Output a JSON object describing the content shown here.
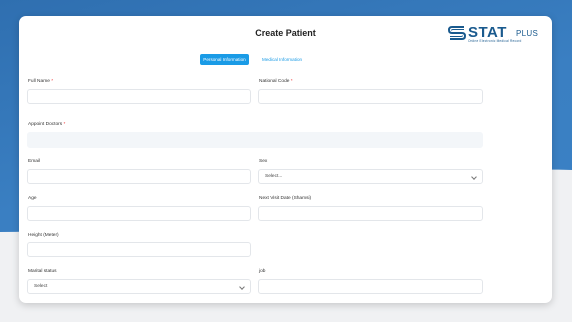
{
  "header": {
    "title": "Create Patient"
  },
  "logo": {
    "word": "STAT",
    "plus": "PLUS",
    "tagline": "Online Electronic Medical Record"
  },
  "tabs": [
    {
      "label": "Personal Information",
      "active": true
    },
    {
      "label": "Medical Information",
      "active": false
    }
  ],
  "form": {
    "full_name": {
      "label": "Full Name",
      "required_mark": "*",
      "value": ""
    },
    "national_code": {
      "label": "National Code",
      "required_mark": "*",
      "value": ""
    },
    "appoint_doctors": {
      "label": "Appoint Doctors",
      "required_mark": "*",
      "value": ""
    },
    "email": {
      "label": "Email",
      "value": ""
    },
    "sex": {
      "label": "Sex",
      "value": "Select..."
    },
    "age": {
      "label": "Age",
      "value": ""
    },
    "next_visit": {
      "label": "Next Visit Date (Shamsi)",
      "value": ""
    },
    "height": {
      "label": "Height (Meter)",
      "value": ""
    },
    "marital_status": {
      "label": "Marital status",
      "value": "Select"
    },
    "job": {
      "label": "job",
      "value": ""
    }
  },
  "colors": {
    "accent": "#1a9be6",
    "background": "#3b82c6",
    "logo": "#1a5a8e"
  }
}
